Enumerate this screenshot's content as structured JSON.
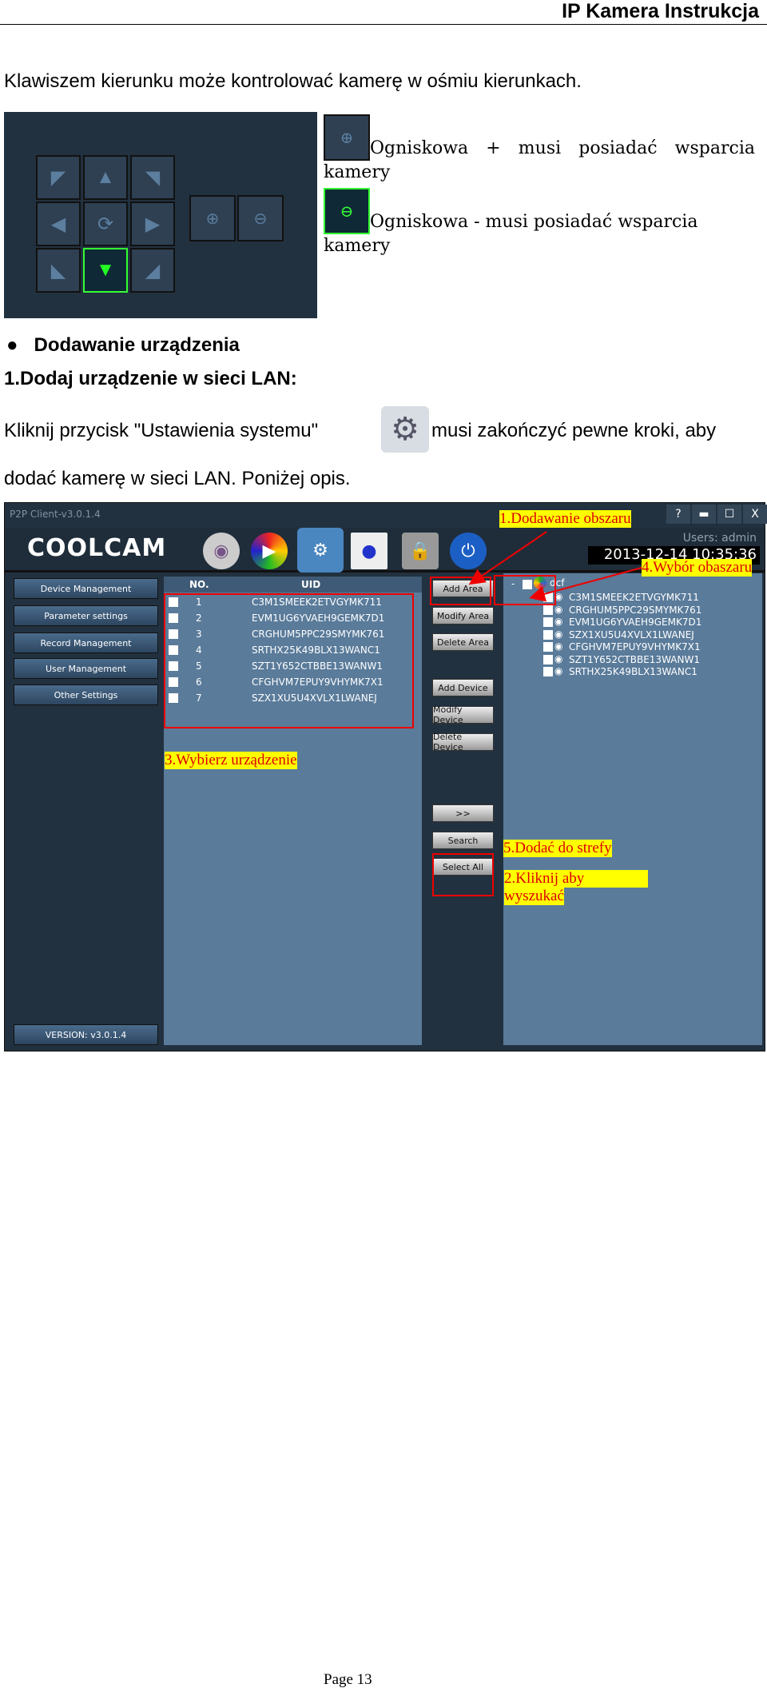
{
  "header": {
    "title": "IP Kamera Instrukcja"
  },
  "intro": "Klawiszem kierunku może kontrolować kamerę w ośmiu kierunkach.",
  "ptz": {
    "zoom_in_desc": "Ogniskowa + musi posiadać wsparcia kamery",
    "zoom_out_desc": "Ogniskowa - musi posiadać wsparcia kamery",
    "active_color": "#33ff33"
  },
  "section": {
    "bullet": "Dodawanie urządzenia",
    "subheading": "1.Dodaj urządzenie w sieci LAN:",
    "para1_before": "Kliknij przycisk \"Ustawienia systemu\"",
    "para1_after": "musi zakończyć pewne kroki, aby",
    "para2": "dodać kamerę w sieci LAN. Poniżej opis."
  },
  "app": {
    "window_title": "P2P Client-v3.0.1.4",
    "logo": "COOLCAM",
    "toolbar_icons": [
      "webcam-icon",
      "playback-icon",
      "settings-icon",
      "log-icon",
      "lock-icon",
      "power-icon"
    ],
    "users": "Users: admin",
    "datetime": "2013-12-14 10:35:36",
    "sidebar": [
      "Device Management",
      "Parameter settings",
      "Record Management",
      "User Management",
      "Other Settings"
    ],
    "version": "VERSION: v3.0.1.4",
    "table": {
      "columns": [
        "NO.",
        "UID"
      ],
      "rows": [
        [
          "1",
          "C3M1SMEEK2ETVGYMK711"
        ],
        [
          "2",
          "EVM1UG6YVAEH9GEMK7D1"
        ],
        [
          "3",
          "CRGHUM5PPC29SMYMK761"
        ],
        [
          "4",
          "SRTHX25K49BLX13WANC1"
        ],
        [
          "5",
          "SZT1Y652CTBBE13WANW1"
        ],
        [
          "6",
          "CFGHVM7EPUY9VHYMK7X1"
        ],
        [
          "7",
          "SZX1XU5U4XVLX1LWANEJ"
        ]
      ]
    },
    "buttons": [
      "Add Area",
      "Modify Area",
      "Delete Area",
      "Add Device",
      "Modify Device",
      "Delete Device",
      ">>",
      "Search",
      "Select All"
    ],
    "tree": {
      "root": "dcf",
      "children": [
        "C3M1SMEEK2ETVGYMK711",
        "CRGHUM5PPC29SMYMK761",
        "EVM1UG6YVAEH9GEMK7D1",
        "SZX1XU5U4XVLX1LWANEJ",
        "CFGHVM7EPUY9VHYMK7X1",
        "SZT1Y652CTBBE13WANW1",
        "SRTHX25K49BLX13WANC1"
      ]
    },
    "annotations": {
      "a1": "1.Dodawanie obszaru",
      "a2_l1": "2.Kliknij aby",
      "a2_l2": "wyszukać",
      "a3": "3.Wybierz urządzenie",
      "a4": "4.Wybór obaszaru",
      "a5": "5.Dodać do strefy"
    }
  },
  "footer": {
    "page": "Page 13"
  }
}
